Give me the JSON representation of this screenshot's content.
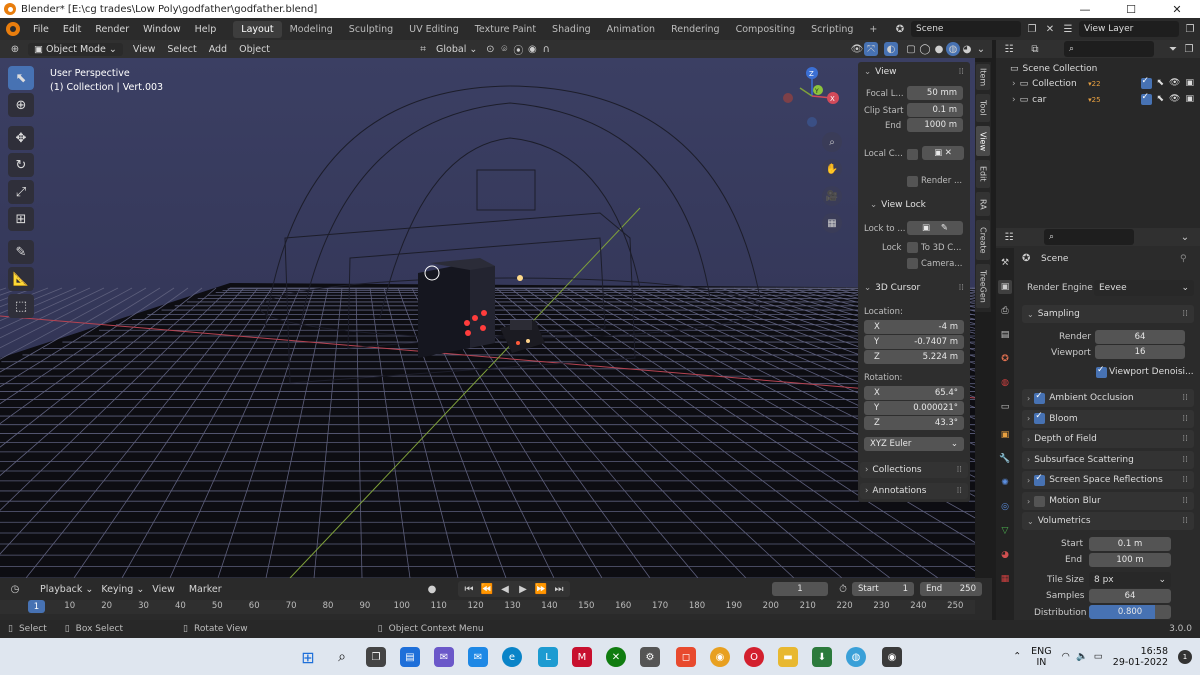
{
  "titlebar": {
    "title": "Blender* [E:\\cg trades\\Low Poly\\godfather\\godfather.blend]",
    "minimize": "—",
    "maximize": "☐",
    "close": "✕"
  },
  "menu": {
    "items": [
      "File",
      "Edit",
      "Render",
      "Window",
      "Help"
    ]
  },
  "workspaces": [
    "Layout",
    "Modeling",
    "Sculpting",
    "UV Editing",
    "Texture Paint",
    "Shading",
    "Animation",
    "Rendering",
    "Compositing",
    "Scripting",
    "+"
  ],
  "scene": {
    "name": "Scene",
    "view_layer": "View Layer"
  },
  "viewport_header": {
    "mode": "Object Mode",
    "items": [
      "View",
      "Select",
      "Add",
      "Object"
    ],
    "orientation": "Global"
  },
  "viewport": {
    "info_line1": "User Perspective",
    "info_line2": "(1) Collection | Vert.003"
  },
  "npanel": {
    "view": {
      "title": "View",
      "focal_label": "Focal L...",
      "focal": "50 mm",
      "clip_start_label": "Clip Start",
      "clip_start": "0.1 m",
      "end_label": "End",
      "end": "1000 m",
      "local_label": "Local C...",
      "render_label": "Render ..."
    },
    "view_lock": {
      "title": "View Lock",
      "lock_to_label": "Lock to ...",
      "lock_label": "Lock",
      "to3d": "To 3D C...",
      "camera": "Camera..."
    },
    "cursor": {
      "title": "3D Cursor",
      "location_label": "Location:",
      "loc": [
        {
          "axis": "X",
          "val": "-4 m"
        },
        {
          "axis": "Y",
          "val": "-0.7407 m"
        },
        {
          "axis": "Z",
          "val": "5.224 m"
        }
      ],
      "rotation_label": "Rotation:",
      "rot": [
        {
          "axis": "X",
          "val": "65.4°"
        },
        {
          "axis": "Y",
          "val": "0.000021°"
        },
        {
          "axis": "Z",
          "val": "43.3°"
        }
      ],
      "mode": "XYZ Euler"
    },
    "collections": "Collections",
    "annotations": "Annotations",
    "tabs": [
      "Item",
      "Tool",
      "View",
      "Edit",
      "RA",
      "Create",
      "TreeGen"
    ]
  },
  "outliner": {
    "root": "Scene Collection",
    "rows": [
      {
        "name": "Collection",
        "badge": "22"
      },
      {
        "name": "car",
        "badge": "25"
      }
    ]
  },
  "properties": {
    "scene_label": "Scene",
    "render_engine_label": "Render Engine",
    "render_engine": "Eevee",
    "sampling": {
      "title": "Sampling",
      "render_label": "Render",
      "render": "64",
      "viewport_label": "Viewport",
      "viewport": "16",
      "denoise": "Viewport Denoisi..."
    },
    "sections": [
      {
        "label": "Ambient Occlusion",
        "checkbox": true,
        "checked": true
      },
      {
        "label": "Bloom",
        "checkbox": true,
        "checked": true
      },
      {
        "label": "Depth of Field",
        "checkbox": false,
        "checked": false
      },
      {
        "label": "Subsurface Scattering",
        "checkbox": false,
        "checked": false
      },
      {
        "label": "Screen Space Reflections",
        "checkbox": true,
        "checked": true
      },
      {
        "label": "Motion Blur",
        "checkbox": true,
        "checked": false
      }
    ],
    "volumetrics": {
      "title": "Volumetrics",
      "start_label": "Start",
      "start": "0.1 m",
      "end_label": "End",
      "end": "100 m",
      "tile_label": "Tile Size",
      "tile": "8 px",
      "samples_label": "Samples",
      "samples": "64",
      "distribution_label": "Distribution",
      "distribution": "0.800",
      "distribution_value": 0.8
    }
  },
  "timeline": {
    "items": [
      "Playback",
      "Keying",
      "View",
      "Marker"
    ],
    "current_frame": "1",
    "start_label": "Start",
    "start": "1",
    "end_label": "End",
    "end": "250",
    "ticks": [
      "1",
      "10",
      "20",
      "30",
      "40",
      "50",
      "60",
      "70",
      "80",
      "90",
      "100",
      "110",
      "120",
      "130",
      "140",
      "150",
      "160",
      "170",
      "180",
      "190",
      "200",
      "210",
      "220",
      "230",
      "240",
      "250"
    ]
  },
  "status": {
    "select": "Select",
    "box_select": "Box Select",
    "rotate": "Rotate View",
    "context": "Object Context Menu",
    "version": "3.0.0"
  },
  "taskbar": {
    "lang1": "ENG",
    "lang2": "IN",
    "time": "16:58",
    "date": "29-01-2022"
  }
}
